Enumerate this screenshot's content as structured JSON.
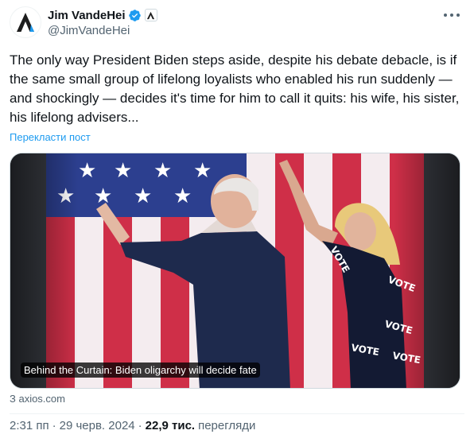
{
  "author": {
    "name": "Jim VandeHei",
    "handle": "@JimVandeHei",
    "verified_color": "#1d9bf0",
    "avatar_icon": "axios-logo-icon",
    "affiliation_icon": "axios-affiliate-icon"
  },
  "tweet": {
    "text": "The only way President Biden steps aside, despite his debate debacle, is if the same small group of lifelong loyalists who enabled his run suddenly — and shockingly — decides it's time for him to call it quits: his wife, his sister, his lifelong advisers...",
    "translate_label": "Перекласти пост"
  },
  "card": {
    "caption": "Behind the Curtain: Biden oligarchy will decide fate",
    "source": "З axios.com"
  },
  "meta": {
    "time": "2:31 пп",
    "date": "29 черв. 2024",
    "views_count": "22,9 тис.",
    "views_label": "перегляди"
  },
  "colors": {
    "link": "#1d9bf0",
    "secondary_text": "#536471",
    "primary_text": "#0f1419"
  }
}
